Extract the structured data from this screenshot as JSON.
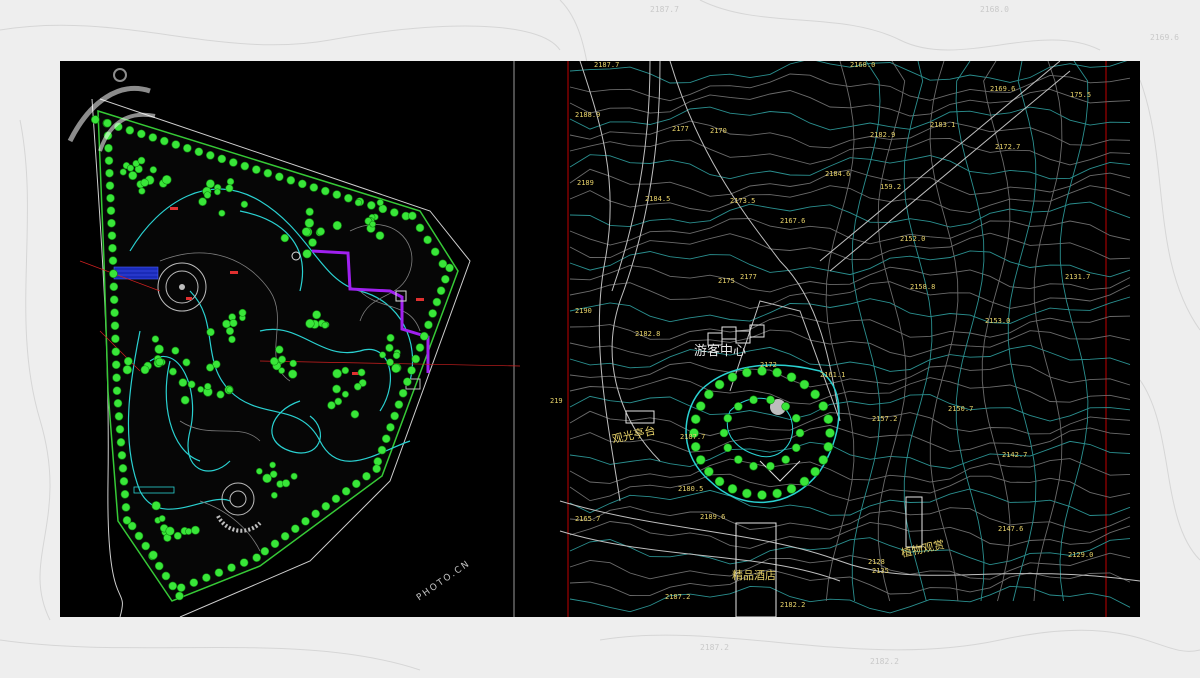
{
  "colors": {
    "background": "#eeeeee",
    "canvas": "#000000",
    "tree": "#39e639",
    "path": "#2ad1d1",
    "boardwalk": "#a020f0",
    "bridge": "#2233cc",
    "contour": "#2a8f8f",
    "label": "#e8d36a",
    "frame_border": "#c00000"
  },
  "watermark": {
    "text": "PHOTO.CN",
    "icon": "nipic-logo-icon"
  },
  "left_panel": {
    "title": "park-master-plan",
    "icons": [
      "tree-symbol-icon",
      "plaza-icon",
      "boardwalk-icon",
      "bridge-icon"
    ]
  },
  "right_panel": {
    "labels": {
      "center": "游客中心",
      "left_note": "观光亭台",
      "bottom": "精品酒店",
      "right": "植物观赏"
    },
    "elevations": [
      "2187.7",
      "2188.9",
      "2177",
      "2170",
      "2168.0",
      "2169.6",
      "175.5",
      "2183.1",
      "2182.9",
      "2172.7",
      "2189",
      "2184.6",
      "2184.5",
      "2173.5",
      "2167.6",
      "159.2",
      "2152.0",
      "2131.7",
      "2175",
      "2177",
      "2158.8",
      "2190",
      "2182.8",
      "2153.0",
      "2161.1",
      "2172",
      "219",
      "2157.2",
      "2150.7",
      "2187.7",
      "2142.7",
      "2180.5",
      "2165.7",
      "2189.6",
      "2147.6",
      "2129.0",
      "2187.2",
      "2182.2",
      "2128",
      "2135"
    ]
  }
}
